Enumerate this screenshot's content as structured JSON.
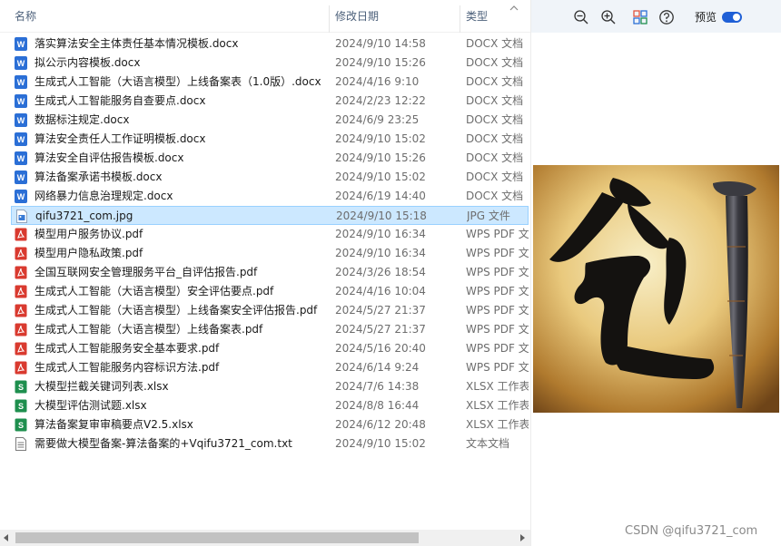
{
  "columns": {
    "name": "名称",
    "date": "修改日期",
    "type": "类型"
  },
  "files": [
    {
      "name": "落实算法安全主体责任基本情况模板.docx",
      "date": "2024/9/10 14:58",
      "type": "DOCX 文档",
      "kind": "docx"
    },
    {
      "name": "拟公示内容模板.docx",
      "date": "2024/9/10 15:26",
      "type": "DOCX 文档",
      "kind": "docx"
    },
    {
      "name": "生成式人工智能（大语言模型）上线备案表（1.0版）.docx",
      "date": "2024/4/16 9:10",
      "type": "DOCX 文档",
      "kind": "docx"
    },
    {
      "name": "生成式人工智能服务自查要点.docx",
      "date": "2024/2/23 12:22",
      "type": "DOCX 文档",
      "kind": "docx"
    },
    {
      "name": "数据标注规定.docx",
      "date": "2024/6/9 23:25",
      "type": "DOCX 文档",
      "kind": "docx"
    },
    {
      "name": "算法安全责任人工作证明模板.docx",
      "date": "2024/9/10 15:02",
      "type": "DOCX 文档",
      "kind": "docx"
    },
    {
      "name": "算法安全自评估报告模板.docx",
      "date": "2024/9/10 15:26",
      "type": "DOCX 文档",
      "kind": "docx"
    },
    {
      "name": "算法备案承诺书模板.docx",
      "date": "2024/9/10 15:02",
      "type": "DOCX 文档",
      "kind": "docx"
    },
    {
      "name": "网络暴力信息治理规定.docx",
      "date": "2024/6/19 14:40",
      "type": "DOCX 文档",
      "kind": "docx"
    },
    {
      "name": "qifu3721_com.jpg",
      "date": "2024/9/10 15:18",
      "type": "JPG 文件",
      "kind": "jpg",
      "selected": true
    },
    {
      "name": "模型用户服务协议.pdf",
      "date": "2024/9/10 16:34",
      "type": "WPS PDF 文档",
      "kind": "pdf"
    },
    {
      "name": "模型用户隐私政策.pdf",
      "date": "2024/9/10 16:34",
      "type": "WPS PDF 文档",
      "kind": "pdf"
    },
    {
      "name": "全国互联网安全管理服务平台_自评估报告.pdf",
      "date": "2024/3/26 18:54",
      "type": "WPS PDF 文档",
      "kind": "pdf"
    },
    {
      "name": "生成式人工智能（大语言模型）安全评估要点.pdf",
      "date": "2024/4/16 10:04",
      "type": "WPS PDF 文档",
      "kind": "pdf"
    },
    {
      "name": "生成式人工智能（大语言模型）上线备案安全评估报告.pdf",
      "date": "2024/5/27 21:37",
      "type": "WPS PDF 文档",
      "kind": "pdf"
    },
    {
      "name": "生成式人工智能（大语言模型）上线备案表.pdf",
      "date": "2024/5/27 21:37",
      "type": "WPS PDF 文档",
      "kind": "pdf"
    },
    {
      "name": "生成式人工智能服务安全基本要求.pdf",
      "date": "2024/5/16 20:40",
      "type": "WPS PDF 文档",
      "kind": "pdf"
    },
    {
      "name": "生成式人工智能服务内容标识方法.pdf",
      "date": "2024/6/14 9:24",
      "type": "WPS PDF 文档",
      "kind": "pdf"
    },
    {
      "name": "大模型拦截关键词列表.xlsx",
      "date": "2024/7/6 14:38",
      "type": "XLSX 工作表",
      "kind": "xlsx"
    },
    {
      "name": "大模型评估测试题.xlsx",
      "date": "2024/8/8 16:44",
      "type": "XLSX 工作表",
      "kind": "xlsx"
    },
    {
      "name": "算法备案复审审稿要点V2.5.xlsx",
      "date": "2024/6/12 20:48",
      "type": "XLSX 工作表",
      "kind": "xlsx"
    },
    {
      "name": "需要做大模型备案-算法备案的+Vqifu3721_com.txt",
      "date": "2024/9/10 15:02",
      "type": "文本文档",
      "kind": "txt"
    }
  ],
  "toolbar": {
    "icons": [
      "zoom-out-icon",
      "zoom-in-icon",
      "layout-grid-icon",
      "help-icon"
    ],
    "preview_label": "预览",
    "preview_enabled": true
  },
  "preview": {
    "image_name": "qifu3721_com.jpg",
    "depicts": "calligraphy-character-with-iron-nail-icon"
  },
  "watermark": "CSDN @qifu3721_com",
  "colors": {
    "selection_bg": "#cce8ff",
    "selection_border": "#99d1ff",
    "docx": "#2b6fd6",
    "pdf": "#d93a2f",
    "xlsx": "#1e8f4e",
    "toggle": "#1f5fd6"
  }
}
